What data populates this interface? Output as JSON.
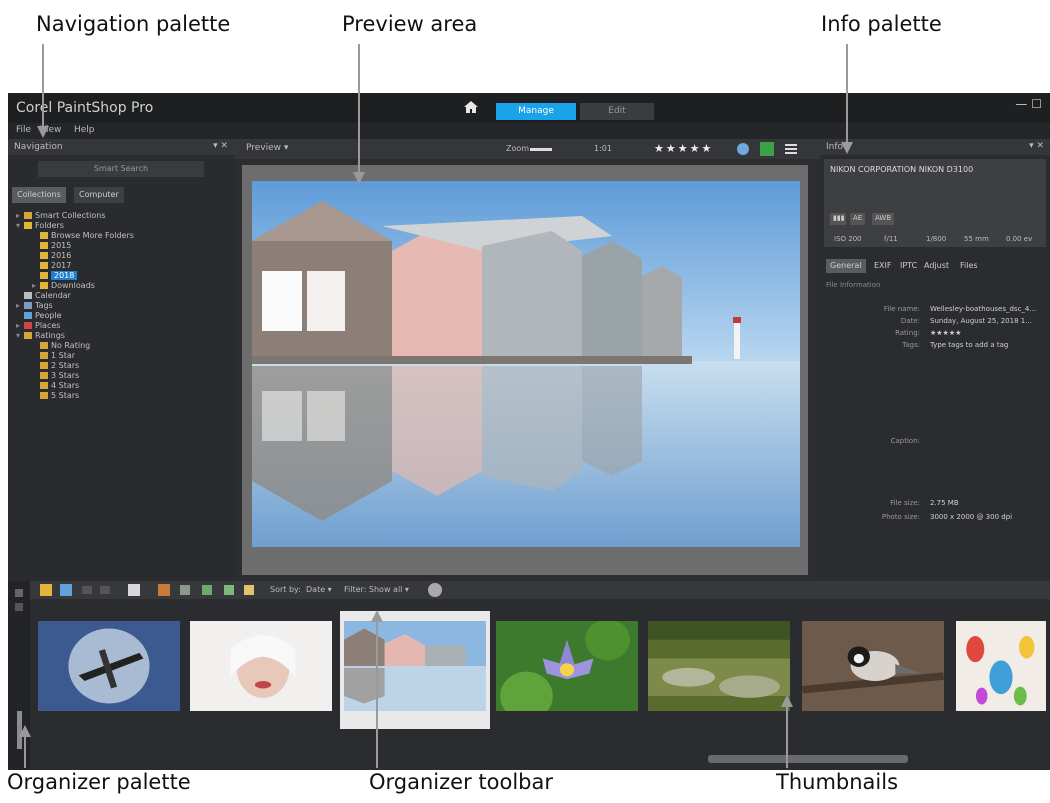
{
  "callouts": {
    "navigation_palette": "Navigation palette",
    "preview_area": "Preview area",
    "info_palette": "Info palette",
    "organizer_palette": "Organizer palette",
    "organizer_toolbar": "Organizer toolbar",
    "thumbnails": "Thumbnails"
  },
  "app": {
    "title": "Corel PaintShop Pro",
    "tabs": {
      "manage": "Manage",
      "edit": "Edit"
    },
    "window_controls": "— ☐",
    "menu": [
      "File",
      "View",
      "Help"
    ]
  },
  "navigation": {
    "header": "Navigation",
    "header_controls": "▾ ✕",
    "search_button": "Smart Search",
    "tabs": [
      "Collections",
      "Computer"
    ],
    "tree": [
      {
        "indent": 2,
        "expander": "▸",
        "icon": "sm",
        "label": "Smart Collections"
      },
      {
        "indent": 2,
        "expander": "▾",
        "icon": "folder",
        "label": "Folders"
      },
      {
        "indent": 18,
        "expander": "",
        "icon": "folder",
        "label": "Browse More Folders"
      },
      {
        "indent": 18,
        "expander": "",
        "icon": "folder",
        "label": "2015"
      },
      {
        "indent": 18,
        "expander": "",
        "icon": "folder",
        "label": "2016"
      },
      {
        "indent": 18,
        "expander": "",
        "icon": "folder",
        "label": "2017"
      },
      {
        "indent": 18,
        "expander": "",
        "icon": "folder",
        "label": "2018",
        "selected": true
      },
      {
        "indent": 18,
        "expander": "▸",
        "icon": "folder",
        "label": "Downloads"
      },
      {
        "indent": 2,
        "expander": "",
        "icon": "cal",
        "label": "Calendar"
      },
      {
        "indent": 2,
        "expander": "▸",
        "icon": "tag",
        "label": "Tags"
      },
      {
        "indent": 2,
        "expander": "",
        "icon": "pe",
        "label": "People"
      },
      {
        "indent": 2,
        "expander": "▸",
        "icon": "ev",
        "label": "Places"
      },
      {
        "indent": 2,
        "expander": "▾",
        "icon": "sm",
        "label": "Ratings"
      },
      {
        "indent": 18,
        "expander": "",
        "icon": "sm",
        "label": "No Rating"
      },
      {
        "indent": 18,
        "expander": "",
        "icon": "sm",
        "label": "1 Star"
      },
      {
        "indent": 18,
        "expander": "",
        "icon": "sm",
        "label": "2 Stars"
      },
      {
        "indent": 18,
        "expander": "",
        "icon": "sm",
        "label": "3 Stars"
      },
      {
        "indent": 18,
        "expander": "",
        "icon": "sm",
        "label": "4 Stars"
      },
      {
        "indent": 18,
        "expander": "",
        "icon": "sm",
        "label": "5 Stars"
      }
    ]
  },
  "preview": {
    "toolbar_label": "Preview ▾",
    "zoom_label": "Zoom",
    "zoom_value": "1:01",
    "rating_stars": "★★★★★"
  },
  "info": {
    "header": "Info",
    "header_controls": "▾ ✕",
    "camera_name": "NIKON CORPORATION NIKON D3100",
    "mode_buttons": [
      "AE",
      "AWB"
    ],
    "exif": [
      "ISO 200",
      "f/11",
      "1/800",
      "55 mm",
      "0.00 ev"
    ],
    "tabs": [
      "General",
      "EXIF",
      "IPTC",
      "Adjust",
      "Files"
    ],
    "section_title": "File Information",
    "fields": [
      {
        "label": "File name:",
        "value": "Wellesley-boathouses_dsc_4..."
      },
      {
        "label": "Date:",
        "value": "Sunday, August 25, 2018 1..."
      },
      {
        "label": "Rating:",
        "value": "★★★★★"
      },
      {
        "label": "Tags:",
        "value": "Type tags to add a tag"
      },
      {
        "label": "Caption:",
        "value": ""
      },
      {
        "label": "File size:",
        "value": "2.75 MB"
      },
      {
        "label": "Photo size:",
        "value": "3000 x 2000 @ 300 dpi"
      }
    ]
  },
  "organizer": {
    "toolbar_texts": [
      "Sort by:",
      "Date ▾",
      "Filter: Show all ▾"
    ],
    "thumbnails": [
      {
        "name": "airplane",
        "selected": false
      },
      {
        "name": "woman-portrait",
        "selected": false
      },
      {
        "name": "boathouses",
        "selected": true
      },
      {
        "name": "water-lily",
        "selected": false
      },
      {
        "name": "forest-stream",
        "selected": false
      },
      {
        "name": "chickadee-bird",
        "selected": false
      },
      {
        "name": "colorful-painting",
        "selected": false
      }
    ]
  },
  "colors": {
    "accent": "#1aa3e8",
    "background": "#2f3033"
  }
}
